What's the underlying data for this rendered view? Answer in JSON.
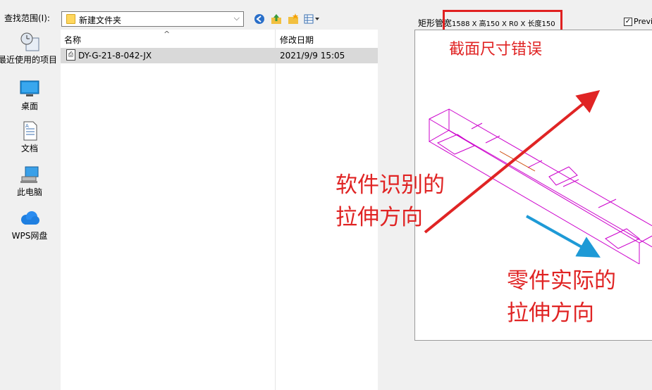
{
  "toolbar": {
    "look_in_label": "查找范围(I):",
    "path": "新建文件夹"
  },
  "places": [
    {
      "label": "最近使用的项目",
      "icon": "recent-icon"
    },
    {
      "label": "桌面",
      "icon": "desktop-icon"
    },
    {
      "label": "文档",
      "icon": "documents-icon"
    },
    {
      "label": "此电脑",
      "icon": "computer-icon"
    },
    {
      "label": "WPS网盘",
      "icon": "cloud-icon"
    }
  ],
  "file_list": {
    "columns": [
      "名称",
      "修改日期"
    ],
    "rows": [
      {
        "name": "DY-G-21-8-042-JX",
        "date": "2021/9/9 15:05"
      }
    ]
  },
  "preview": {
    "label_prefix": "矩形管宽",
    "label_dims": "1588 X 高150 X R0 X 长度150",
    "checkbox_label": "Previ"
  },
  "annotations": {
    "top": "截面尺寸错误",
    "mid_line1": "软件识别的",
    "mid_line2": "拉伸方向",
    "bottom_line1": "零件实际的",
    "bottom_line2": "拉伸方向"
  },
  "colors": {
    "annotation_red": "#e02424",
    "arrow_blue": "#1e9ad6",
    "model_magenta": "#cc00cc"
  }
}
